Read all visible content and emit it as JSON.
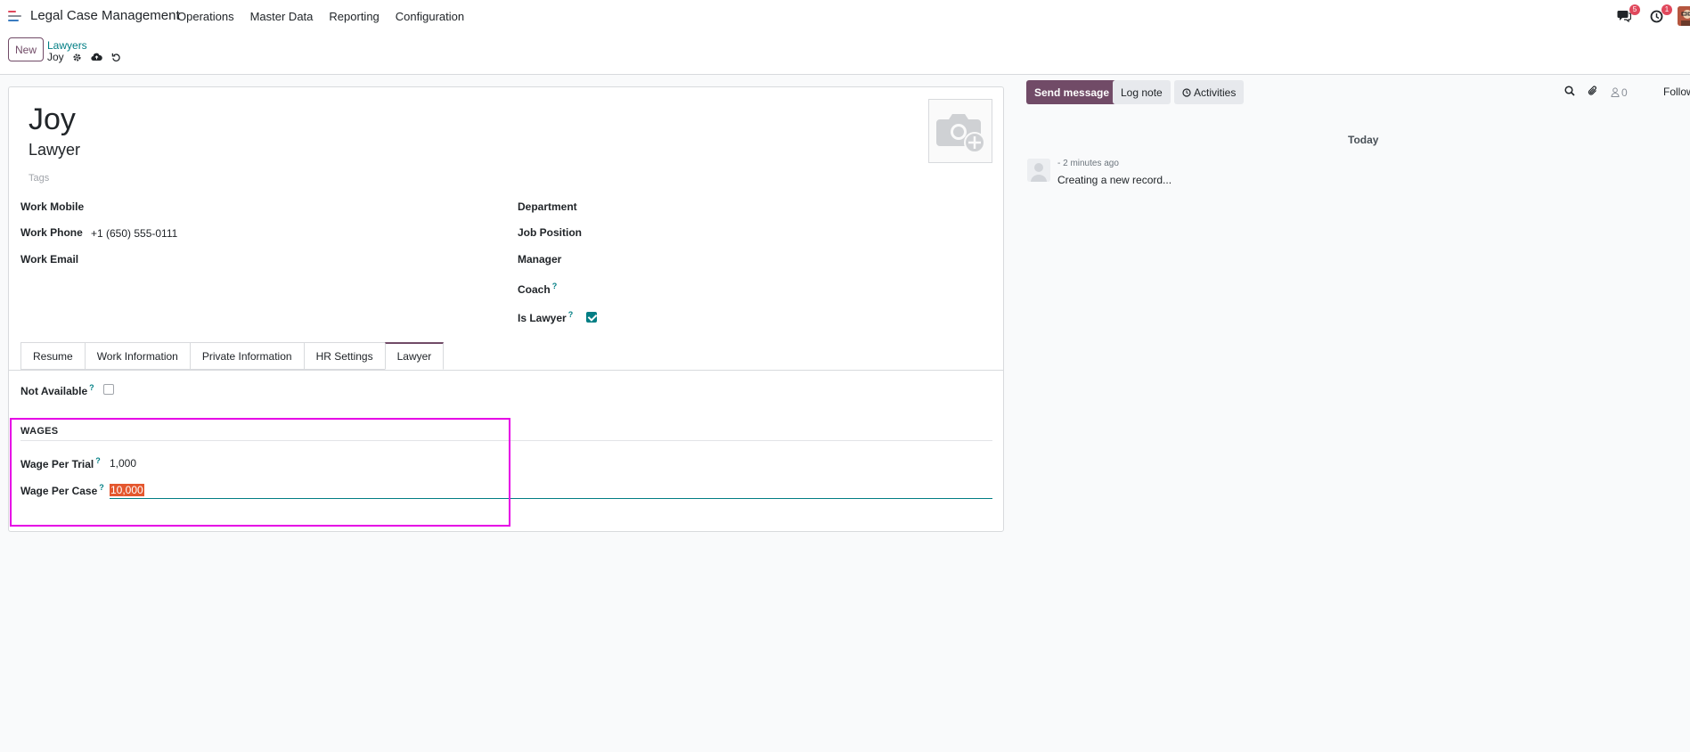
{
  "navbar": {
    "app_name": "Legal Case Management",
    "menu": [
      "Operations",
      "Master Data",
      "Reporting",
      "Configuration"
    ],
    "messages_badge": "5",
    "activities_badge": "1"
  },
  "control": {
    "new_label": "New",
    "breadcrumb_parent": "Lawyers",
    "breadcrumb_current": "Joy"
  },
  "form": {
    "name": "Joy",
    "job_title": "Lawyer",
    "tags_placeholder": "Tags",
    "left_fields": [
      {
        "label": "Work Mobile",
        "value": ""
      },
      {
        "label": "Work Phone",
        "value": "+1 (650) 555-0111"
      },
      {
        "label": "Work Email",
        "value": ""
      }
    ],
    "right_fields": {
      "department": "Department",
      "job_position": "Job Position",
      "manager": "Manager",
      "coach": "Coach",
      "is_lawyer": "Is Lawyer"
    },
    "tabs": [
      "Resume",
      "Work Information",
      "Private Information",
      "HR Settings",
      "Lawyer"
    ],
    "active_tab": "Lawyer",
    "not_available_label": "Not Available",
    "wages_title": "WAGES",
    "wage_per_trial_label": "Wage Per Trial",
    "wage_per_trial_value": "1,000",
    "wage_per_case_label": "Wage Per Case",
    "wage_per_case_value": "10,000"
  },
  "chatter": {
    "send_message": "Send message",
    "log_note": "Log note",
    "activities": "Activities",
    "followers_count": "0",
    "follow_label": "Follow",
    "today_label": "Today",
    "message_meta": "- 2 minutes ago",
    "message_body": "Creating a new record..."
  },
  "colors": {
    "brand": "#714b67",
    "accent": "#017e84",
    "selection": "#e4572e",
    "highlight": "#e600e6"
  }
}
